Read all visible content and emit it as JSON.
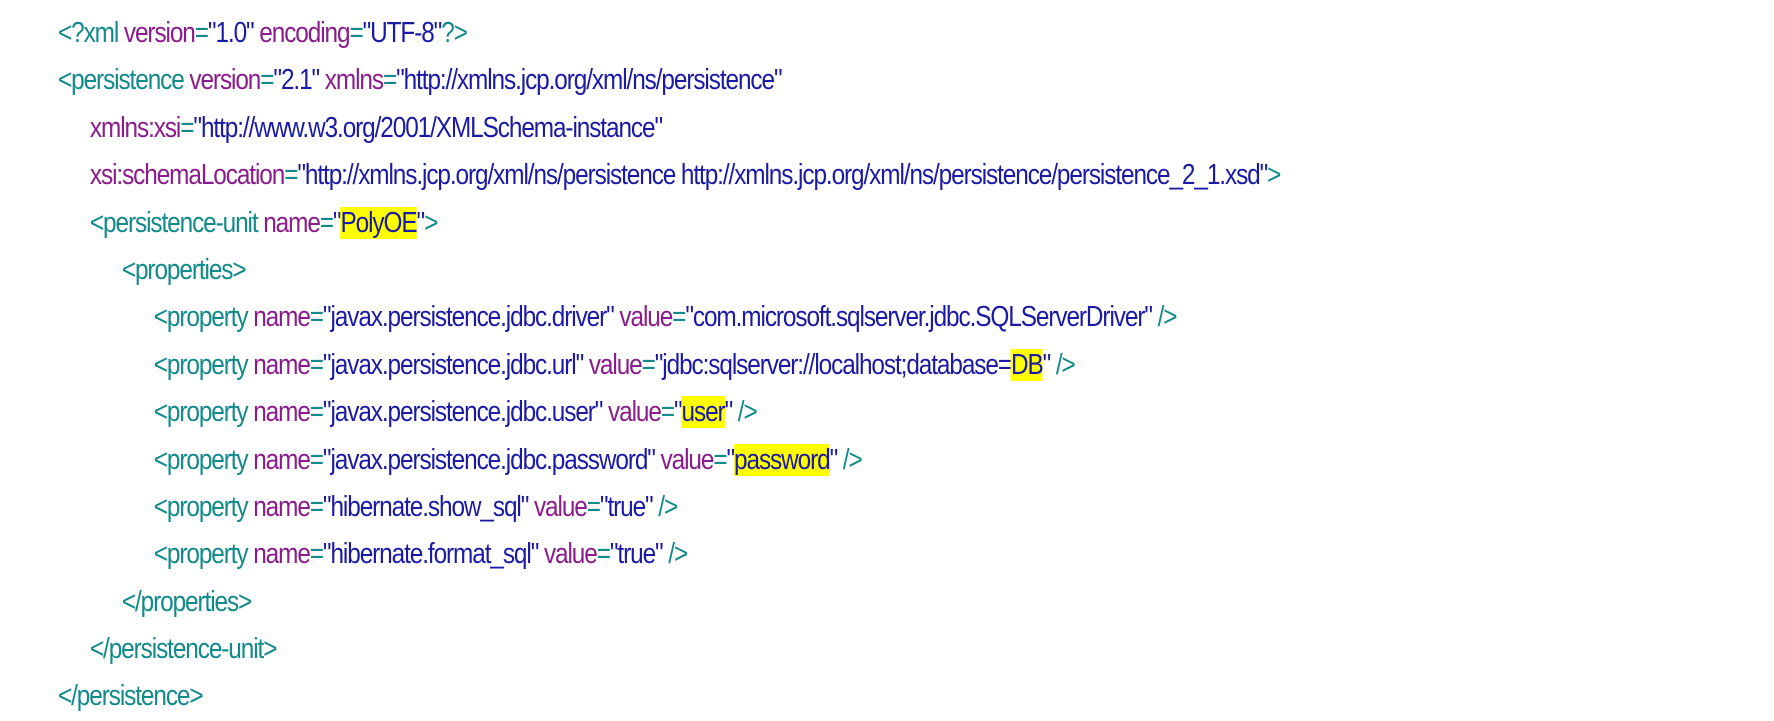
{
  "lines": [
    {
      "indent": 0,
      "tokens": [
        {
          "t": "tag",
          "v": "<?xml "
        },
        {
          "t": "attr",
          "v": "version"
        },
        {
          "t": "eq",
          "v": "="
        },
        {
          "t": "val",
          "v": "\"1.0\""
        },
        {
          "t": "plain",
          "v": " "
        },
        {
          "t": "attr",
          "v": "encoding"
        },
        {
          "t": "eq",
          "v": "="
        },
        {
          "t": "val",
          "v": "\"UTF-8\""
        },
        {
          "t": "tag",
          "v": "?>"
        }
      ]
    },
    {
      "indent": 0,
      "tokens": [
        {
          "t": "tag",
          "v": "<persistence "
        },
        {
          "t": "attr",
          "v": "version"
        },
        {
          "t": "eq",
          "v": "="
        },
        {
          "t": "val",
          "v": "\"2.1\""
        },
        {
          "t": "plain",
          "v": " "
        },
        {
          "t": "attr",
          "v": "xmlns"
        },
        {
          "t": "eq",
          "v": "="
        },
        {
          "t": "val",
          "v": "\"http://xmlns.jcp.org/xml/ns/persistence\""
        }
      ]
    },
    {
      "indent": 1,
      "tokens": [
        {
          "t": "attr",
          "v": "xmlns:xsi"
        },
        {
          "t": "eq",
          "v": "="
        },
        {
          "t": "val",
          "v": "\"http://www.w3.org/2001/XMLSchema-instance\""
        }
      ]
    },
    {
      "indent": 1,
      "tokens": [
        {
          "t": "attr",
          "v": "xsi:schemaLocation"
        },
        {
          "t": "eq",
          "v": "="
        },
        {
          "t": "val",
          "v": "\"http://xmlns.jcp.org/xml/ns/persistence http://xmlns.jcp.org/xml/ns/persistence/persistence_2_1.xsd\""
        },
        {
          "t": "tag",
          "v": ">"
        }
      ]
    },
    {
      "indent": 1,
      "tokens": [
        {
          "t": "tag",
          "v": "<persistence-unit "
        },
        {
          "t": "attr",
          "v": "name"
        },
        {
          "t": "eq",
          "v": "="
        },
        {
          "t": "val",
          "v": "\""
        },
        {
          "t": "hl",
          "v": "PolyOE"
        },
        {
          "t": "val",
          "v": "\""
        },
        {
          "t": "tag",
          "v": ">"
        }
      ]
    },
    {
      "indent": 2,
      "tokens": [
        {
          "t": "tag",
          "v": "<properties>"
        }
      ]
    },
    {
      "indent": 3,
      "tokens": [
        {
          "t": "tag",
          "v": "<property "
        },
        {
          "t": "attr",
          "v": "name"
        },
        {
          "t": "eq",
          "v": "="
        },
        {
          "t": "val",
          "v": "\"javax.persistence.jdbc.driver\""
        },
        {
          "t": "plain",
          "v": " "
        },
        {
          "t": "attr",
          "v": "value"
        },
        {
          "t": "eq",
          "v": "="
        },
        {
          "t": "val",
          "v": "\"com.microsoft.sqlserver.jdbc.SQLServerDriver\""
        },
        {
          "t": "tag",
          "v": " />"
        }
      ]
    },
    {
      "indent": 3,
      "tokens": [
        {
          "t": "tag",
          "v": "<property "
        },
        {
          "t": "attr",
          "v": "name"
        },
        {
          "t": "eq",
          "v": "="
        },
        {
          "t": "val",
          "v": "\"javax.persistence.jdbc.url\""
        },
        {
          "t": "plain",
          "v": " "
        },
        {
          "t": "attr",
          "v": "value"
        },
        {
          "t": "eq",
          "v": "="
        },
        {
          "t": "val",
          "v": "\"jdbc:sqlserver://localhost;database="
        },
        {
          "t": "hl",
          "v": "DB"
        },
        {
          "t": "val",
          "v": "\""
        },
        {
          "t": "tag",
          "v": " />"
        }
      ]
    },
    {
      "indent": 3,
      "tokens": [
        {
          "t": "tag",
          "v": "<property "
        },
        {
          "t": "attr",
          "v": "name"
        },
        {
          "t": "eq",
          "v": "="
        },
        {
          "t": "val",
          "v": "\"javax.persistence.jdbc.user\""
        },
        {
          "t": "plain",
          "v": " "
        },
        {
          "t": "attr",
          "v": "value"
        },
        {
          "t": "eq",
          "v": "="
        },
        {
          "t": "val",
          "v": "\""
        },
        {
          "t": "hl",
          "v": "user"
        },
        {
          "t": "val",
          "v": "\""
        },
        {
          "t": "tag",
          "v": " />"
        }
      ]
    },
    {
      "indent": 3,
      "tokens": [
        {
          "t": "tag",
          "v": "<property "
        },
        {
          "t": "attr",
          "v": "name"
        },
        {
          "t": "eq",
          "v": "="
        },
        {
          "t": "val",
          "v": "\"javax.persistence.jdbc.password\""
        },
        {
          "t": "plain",
          "v": " "
        },
        {
          "t": "attr",
          "v": "value"
        },
        {
          "t": "eq",
          "v": "="
        },
        {
          "t": "val",
          "v": "\""
        },
        {
          "t": "hl",
          "v": "password"
        },
        {
          "t": "val",
          "v": "\""
        },
        {
          "t": "tag",
          "v": " />"
        }
      ]
    },
    {
      "indent": 3,
      "tokens": [
        {
          "t": "tag",
          "v": "<property "
        },
        {
          "t": "attr",
          "v": "name"
        },
        {
          "t": "eq",
          "v": "="
        },
        {
          "t": "val",
          "v": "\"hibernate.show_sql\""
        },
        {
          "t": "plain",
          "v": " "
        },
        {
          "t": "attr",
          "v": "value"
        },
        {
          "t": "eq",
          "v": "="
        },
        {
          "t": "val",
          "v": "\"true\""
        },
        {
          "t": "tag",
          "v": " />"
        }
      ]
    },
    {
      "indent": 3,
      "tokens": [
        {
          "t": "tag",
          "v": "<property "
        },
        {
          "t": "attr",
          "v": "name"
        },
        {
          "t": "eq",
          "v": "="
        },
        {
          "t": "val",
          "v": "\"hibernate.format_sql\""
        },
        {
          "t": "plain",
          "v": " "
        },
        {
          "t": "attr",
          "v": "value"
        },
        {
          "t": "eq",
          "v": "="
        },
        {
          "t": "val",
          "v": "\"true\""
        },
        {
          "t": "tag",
          "v": " />"
        }
      ]
    },
    {
      "indent": 2,
      "tokens": [
        {
          "t": "tag",
          "v": "</properties>"
        }
      ]
    },
    {
      "indent": 1,
      "tokens": [
        {
          "t": "tag",
          "v": "</persistence-unit>"
        }
      ]
    },
    {
      "indent": 0,
      "tokens": [
        {
          "t": "tag",
          "v": "</persistence>"
        }
      ]
    }
  ]
}
